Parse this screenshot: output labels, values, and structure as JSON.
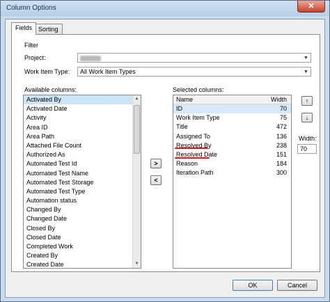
{
  "window": {
    "title": "Column Options",
    "close_glyph": "✕"
  },
  "tabs": [
    {
      "label": "Fields"
    },
    {
      "label": "Sorting"
    }
  ],
  "filter": {
    "group_label": "Filter",
    "project_label": "Project:",
    "work_item_type_label": "Work Item Type:",
    "work_item_type_value": "All Work Item Types"
  },
  "available": {
    "label": "Available columns:",
    "items": [
      "Activated By",
      "Activated Date",
      "Activity",
      "Area ID",
      "Area Path",
      "Attached File Count",
      "Authorized As",
      "Automated Test Id",
      "Automated Test Name",
      "Automated Test Storage",
      "Automated Test Type",
      "Automation status",
      "Changed By",
      "Changed Date",
      "Closed By",
      "Closed Date",
      "Completed Work",
      "Created By",
      "Created Date"
    ]
  },
  "selected": {
    "label": "Selected columns:",
    "header_name": "Name",
    "header_width": "Width",
    "rows": [
      {
        "name": "ID",
        "width": "70"
      },
      {
        "name": "Work Item Type",
        "width": "75"
      },
      {
        "name": "Title",
        "width": "472"
      },
      {
        "name": "Assigned To",
        "width": "136"
      },
      {
        "name": "Resolved By",
        "width": "238"
      },
      {
        "name": "Resolved Date",
        "width": "151"
      },
      {
        "name": "Reason",
        "width": "184"
      },
      {
        "name": "Iteration Path",
        "width": "300"
      }
    ]
  },
  "controls": {
    "add_glyph": ">",
    "remove_glyph": "<",
    "up_glyph": "↑",
    "down_glyph": "↓",
    "width_label": "Width:",
    "width_value": "70"
  },
  "footer": {
    "ok_label": "OK",
    "cancel_label": "Cancel"
  },
  "colors": {
    "annotation": "#d01a1a",
    "selection": "#cde3f6"
  }
}
